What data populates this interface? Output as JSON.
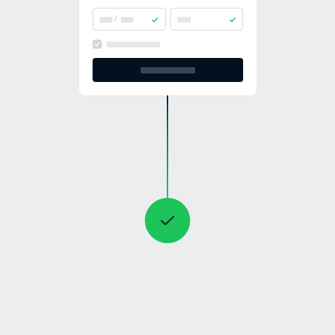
{
  "form": {
    "expiry_field": {
      "separator": "/",
      "valid": true,
      "valid_icon": "checkmark-icon"
    },
    "cvc_field": {
      "valid": true,
      "valid_icon": "checkmark-icon"
    },
    "agree_checkbox": {
      "checked": true,
      "icon": "checkmark-icon"
    },
    "submit_button": {
      "icon": "none"
    }
  },
  "status": {
    "state": "success",
    "icon": "checkmark-icon"
  },
  "colors": {
    "background": "#ECEDEF",
    "card": "#FFFFFF",
    "button": "#02101F",
    "success": "#1CC45A",
    "valid_check": "#1FB96A"
  }
}
